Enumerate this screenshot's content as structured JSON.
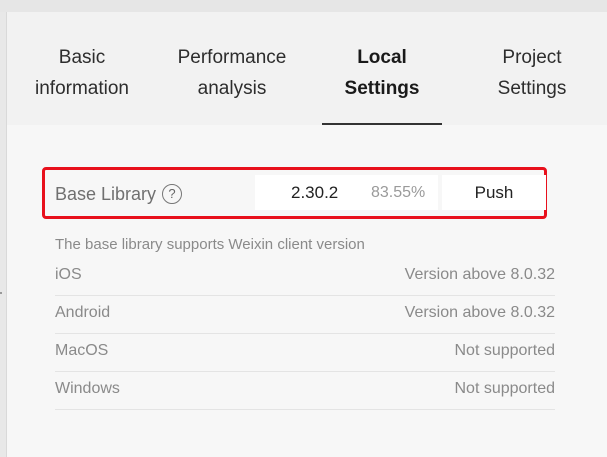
{
  "tabs": [
    {
      "line1": "Basic",
      "line2": "information"
    },
    {
      "line1": "Performance",
      "line2": "analysis"
    },
    {
      "line1": "Local",
      "line2": "Settings"
    },
    {
      "line1": "Project",
      "line2": "Settings"
    }
  ],
  "active_tab": "Local Settings",
  "base_library": {
    "label": "Base Library",
    "help_icon": "?",
    "version": "2.30.2",
    "percent": "83.55%",
    "push_label": "Push",
    "highlight_color": "#e8101c"
  },
  "support": {
    "title": "The base library supports Weixin client version",
    "rows": [
      {
        "platform": "iOS",
        "status": "Version above 8.0.32"
      },
      {
        "platform": "Android",
        "status": "Version above 8.0.32"
      },
      {
        "platform": "MacOS",
        "status": "Not supported"
      },
      {
        "platform": "Windows",
        "status": "Not supported"
      }
    ]
  }
}
